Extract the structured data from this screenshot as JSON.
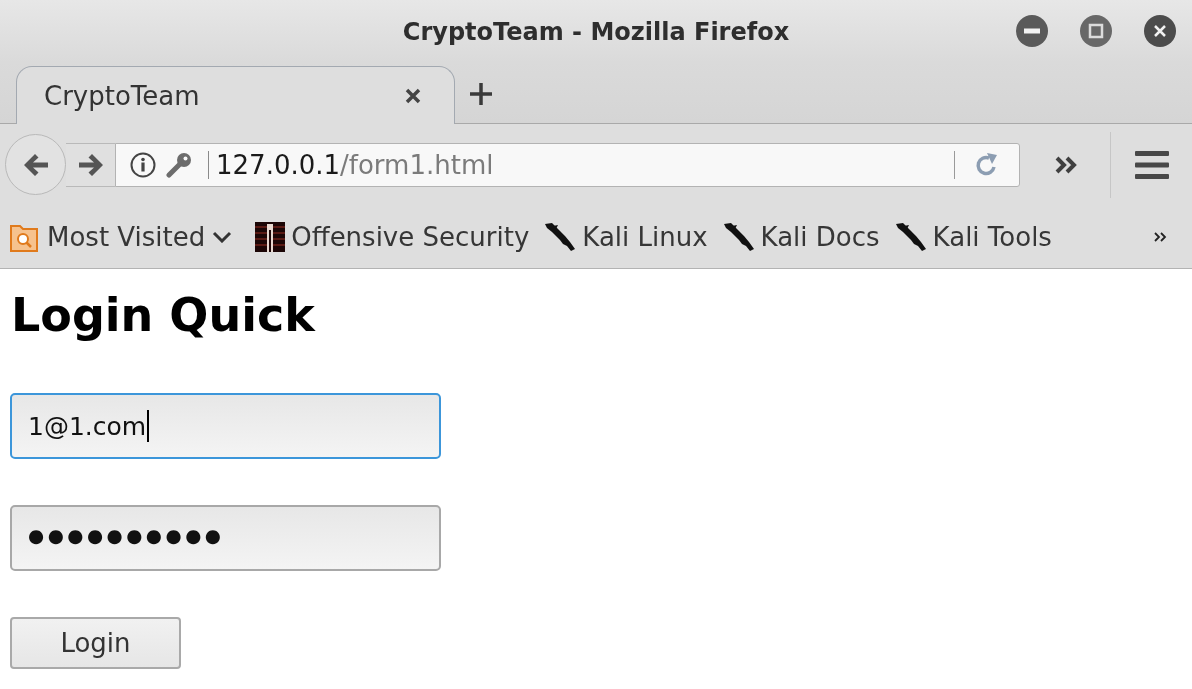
{
  "window": {
    "title": "CryptoTeam - Mozilla Firefox"
  },
  "tabs": [
    {
      "label": "CryptoTeam",
      "selected": true
    }
  ],
  "url_bar": {
    "host": "127.0.0.1",
    "path": "/form1.html"
  },
  "bookmarks": [
    {
      "kind": "folder",
      "label": "Most Visited"
    },
    {
      "kind": "offsec",
      "label": "Offensive Security"
    },
    {
      "kind": "kali",
      "label": "Kali Linux"
    },
    {
      "kind": "kali",
      "label": "Kali Docs"
    },
    {
      "kind": "kali",
      "label": "Kali Tools"
    }
  ],
  "page": {
    "heading": "Login Quick",
    "fields": [
      {
        "kind": "email",
        "value": "1@1.com",
        "focused": true
      },
      {
        "kind": "password",
        "value": "●●●●●●●●●●",
        "focused": false
      }
    ],
    "button": {
      "label": "Login"
    }
  }
}
